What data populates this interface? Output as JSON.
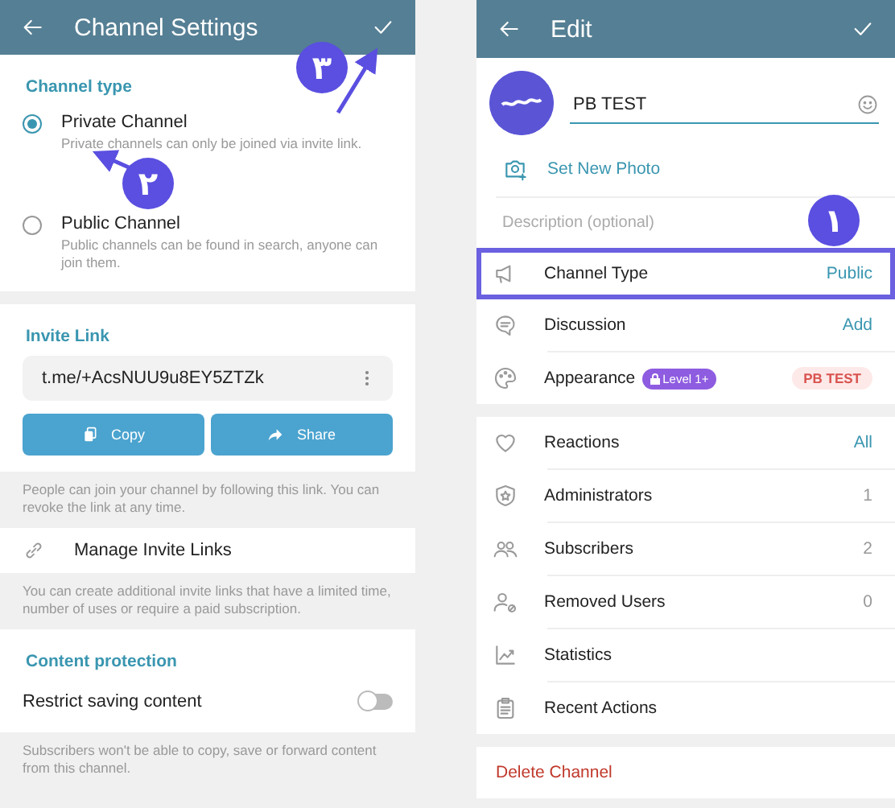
{
  "settings_screen": {
    "header": {
      "title": "Channel Settings"
    },
    "channel_type": {
      "heading": "Channel type",
      "options": [
        {
          "label": "Private Channel",
          "description": "Private channels can only be joined via invite link.",
          "selected": true
        },
        {
          "label": "Public Channel",
          "description": "Public channels can be found in search, anyone can join them.",
          "selected": false
        }
      ]
    },
    "invite_link": {
      "heading": "Invite Link",
      "link": "t.me/+AcsNUU9u8EY5ZTZk",
      "buttons": [
        {
          "kind": "copy",
          "label": "Copy"
        },
        {
          "kind": "share",
          "label": "Share"
        }
      ],
      "hint": "People can join your channel by following this link. You can revoke the link at any time."
    },
    "manage_links": {
      "label": "Manage Invite Links",
      "hint": "You can create additional invite links that have a limited time, number of uses or require a paid subscription."
    },
    "content_protection": {
      "heading": "Content protection",
      "label": "Restrict saving content",
      "on": false,
      "hint": "Subscribers won't be able to copy, save or forward content from this channel."
    }
  },
  "edit_screen": {
    "header": {
      "title": "Edit"
    },
    "name": "PB TEST",
    "set_photo": "Set New Photo",
    "description_placeholder": "Description (optional)",
    "groups": [
      [
        {
          "kind": "megaphone",
          "label": "Channel Type",
          "value": {
            "kind": "link",
            "text": "Public"
          },
          "highlighted": true
        },
        {
          "kind": "chat",
          "label": "Discussion",
          "value": {
            "kind": "link",
            "text": "Add"
          },
          "highlighted": false
        },
        {
          "kind": "palette",
          "label": "Appearance",
          "badge": "Level 1+",
          "value": {
            "kind": "tag",
            "text": "PB TEST"
          },
          "highlighted": false
        }
      ],
      [
        {
          "kind": "heart",
          "label": "Reactions",
          "value": {
            "kind": "link",
            "text": "All"
          },
          "highlighted": false
        },
        {
          "kind": "shield",
          "label": "Administrators",
          "value": {
            "kind": "count",
            "text": "1"
          },
          "highlighted": false
        },
        {
          "kind": "people",
          "label": "Subscribers",
          "value": {
            "kind": "count",
            "text": "2"
          },
          "highlighted": false
        },
        {
          "kind": "removed",
          "label": "Removed Users",
          "value": {
            "kind": "count",
            "text": "0"
          },
          "highlighted": false
        },
        {
          "kind": "chart",
          "label": "Statistics",
          "highlighted": false
        },
        {
          "kind": "clipboard",
          "label": "Recent Actions",
          "highlighted": false
        }
      ]
    ],
    "delete": "Delete Channel"
  },
  "annotations": [
    {
      "label": "۱"
    },
    {
      "label": "۲"
    },
    {
      "label": "۳"
    }
  ]
}
